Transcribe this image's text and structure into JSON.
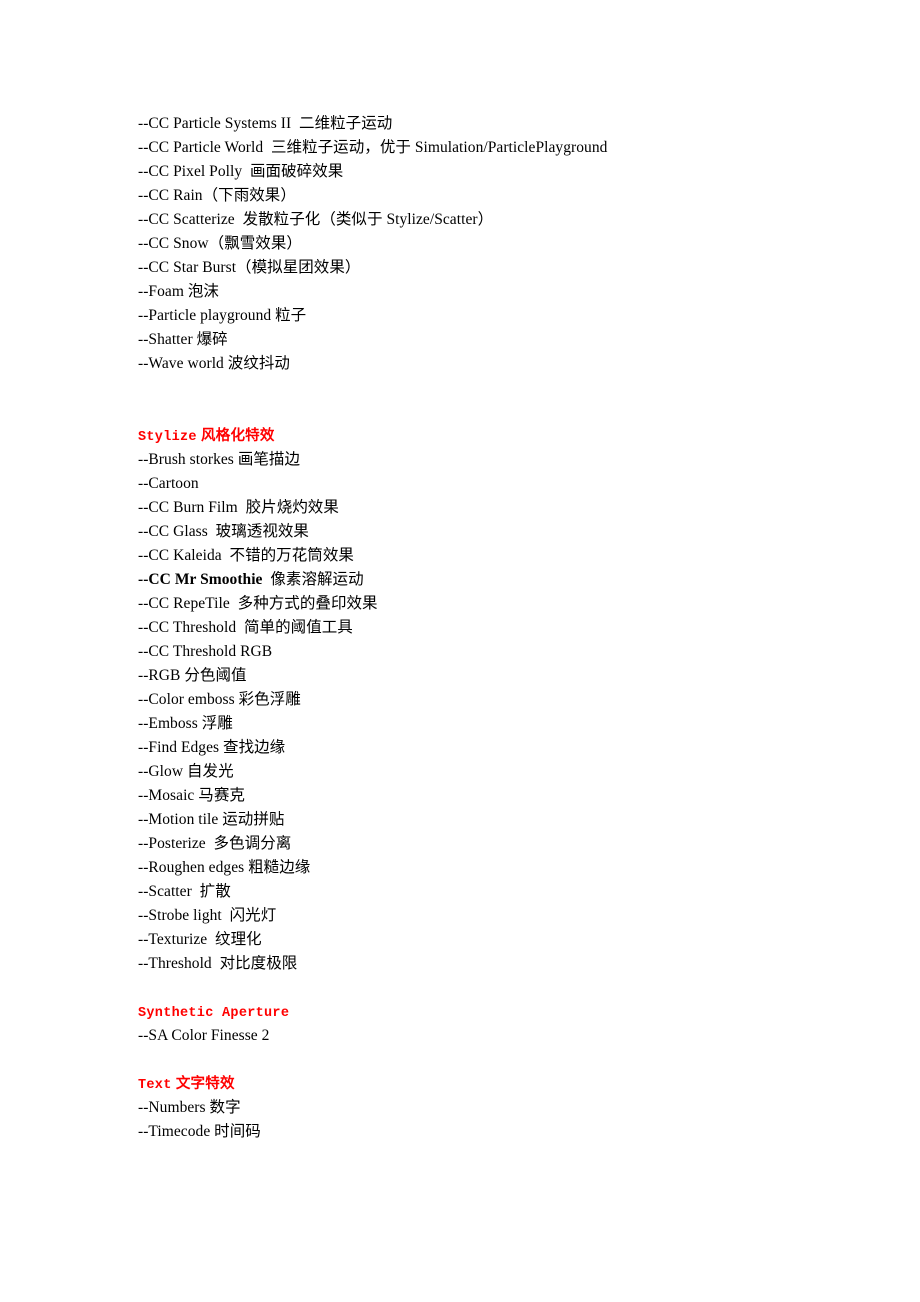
{
  "page": {
    "background_color": "#ffffff",
    "text_color": "#000000",
    "heading_color": "#FF0000"
  },
  "blocks": [
    {
      "type": "list",
      "items": [
        {
          "text": "--CC Particle Systems II  二维粒子运动",
          "bold": false
        },
        {
          "text": "--CC Particle World  三维粒子运动，优于 Simulation/ParticlePlayground",
          "bold": false
        },
        {
          "text": "--CC Pixel Polly  画面破碎效果",
          "bold": false
        },
        {
          "text": "--CC Rain（下雨效果）",
          "bold": false
        },
        {
          "text": "--CC Scatterize  发散粒子化（类似于 Stylize/Scatter）",
          "bold": false
        },
        {
          "text": "--CC Snow（飘雪效果）",
          "bold": false
        },
        {
          "text": "--CC Star Burst（模拟星团效果）",
          "bold": false
        },
        {
          "text": "--Foam 泡沫",
          "bold": false
        },
        {
          "text": "--Particle playground 粒子",
          "bold": false
        },
        {
          "text": "--Shatter 爆碎",
          "bold": false
        },
        {
          "text": "--Wave world 波纹抖动",
          "bold": false
        }
      ]
    },
    {
      "type": "gap",
      "lines": 2
    },
    {
      "type": "heading",
      "english": "Stylize",
      "chinese": " 风格化特效"
    },
    {
      "type": "list",
      "items": [
        {
          "text": "--Brush storkes 画笔描边",
          "bold": false
        },
        {
          "text": "--Cartoon",
          "bold": false
        },
        {
          "text": "--CC Burn Film  胶片烧灼效果",
          "bold": false
        },
        {
          "text": "--CC Glass  玻璃透视效果",
          "bold": false
        },
        {
          "text": "--CC Kaleida  不错的万花筒效果",
          "bold": false
        },
        {
          "text": "--CC Mr Smoothie",
          "tail": "  像素溶解运动",
          "bold": true
        },
        {
          "text": "--CC RepeTile  多种方式的叠印效果",
          "bold": false
        },
        {
          "text": "--CC Threshold  简单的阈值工具",
          "bold": false
        },
        {
          "text": "--CC Threshold RGB",
          "bold": false
        },
        {
          "text": "--RGB 分色阈值",
          "bold": false
        },
        {
          "text": "--Color emboss 彩色浮雕",
          "bold": false
        },
        {
          "text": "--Emboss 浮雕",
          "bold": false
        },
        {
          "text": "--Find Edges 查找边缘",
          "bold": false
        },
        {
          "text": "--Glow 自发光",
          "bold": false
        },
        {
          "text": "--Mosaic 马赛克",
          "bold": false
        },
        {
          "text": "--Motion tile 运动拼贴",
          "bold": false
        },
        {
          "text": "--Posterize  多色调分离",
          "bold": false
        },
        {
          "text": "--Roughen edges 粗糙边缘",
          "bold": false
        },
        {
          "text": "--Scatter  扩散",
          "bold": false
        },
        {
          "text": "--Strobe light  闪光灯",
          "bold": false
        },
        {
          "text": "--Texturize  纹理化",
          "bold": false
        },
        {
          "text": "--Threshold  对比度极限",
          "bold": false
        }
      ]
    },
    {
      "type": "gap",
      "lines": 1
    },
    {
      "type": "heading",
      "english": "Synthetic Aperture",
      "chinese": ""
    },
    {
      "type": "list",
      "items": [
        {
          "text": "--SA Color Finesse 2",
          "bold": false
        }
      ]
    },
    {
      "type": "gap",
      "lines": 1
    },
    {
      "type": "heading",
      "english": "Text",
      "chinese": " 文字特效"
    },
    {
      "type": "list",
      "items": [
        {
          "text": "--Numbers 数字",
          "bold": false
        },
        {
          "text": "--Timecode 时间码",
          "bold": false
        }
      ]
    }
  ]
}
